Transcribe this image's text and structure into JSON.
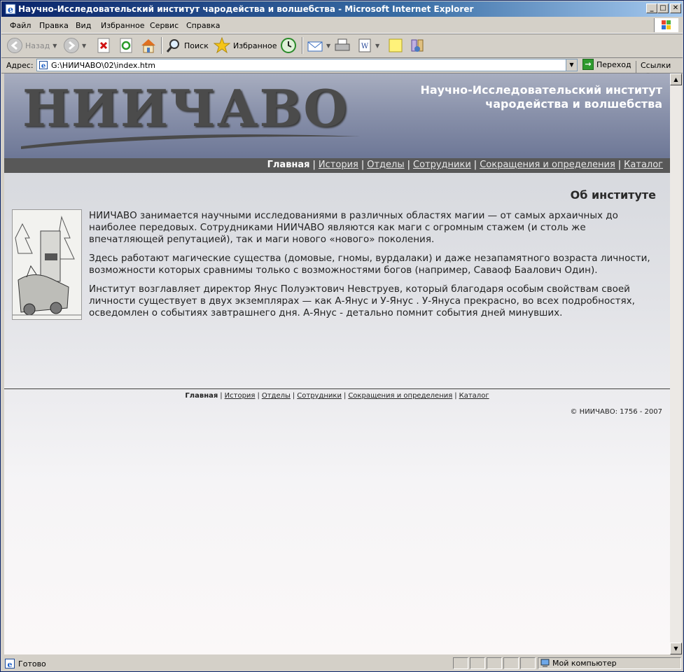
{
  "window": {
    "title": "Научно-Исследовательский институт чародейства и волшебства - Microsoft Internet Explorer",
    "minimize": "_",
    "maximize": "□",
    "close": "✕"
  },
  "menu": {
    "file": "Файл",
    "edit": "Правка",
    "view": "Вид",
    "favorites": "Избранное",
    "tools": "Сервис",
    "help": "Справка"
  },
  "toolbar": {
    "back": "Назад",
    "search": "Поиск",
    "favorites": "Избранное"
  },
  "address": {
    "label": "Адрес:",
    "url": "G:\\НИИЧАВО\\02\\index.htm",
    "go": "Переход",
    "links": "Ссылки",
    "more": "»"
  },
  "page": {
    "logo": "НИИЧАВО",
    "site_title_line1": "Научно-Исследовательский институт",
    "site_title_line2": "чародейства и волшебства",
    "nav": [
      "Главная",
      "История",
      "Отделы",
      "Сотрудники",
      "Сокращения и определения",
      "Каталог"
    ],
    "section_title": "Об институте",
    "paragraphs": [
      "НИИЧАВО занимается научными исследованиями в различных областях магии — от самых архаичных до наиболее передовых. Сотрудниками НИИЧАВО являются как маги с огромным стажем (и столь же впечатляющей репутацией), так и маги нового «нового» поколения.",
      "Здесь работают магические существа (домовые, гномы, вурдалаки) и даже незапамятного возраста личности, возможности которых сравнимы только с возможностями богов (например, Саваоф Баалович Один).",
      "Институт возглавляет директор Янус Полуэктович Невструев, который благодаря особым свойствам своей личности существует в двух экземплярах — как А-Янус и У-Янус . У-Януса прекрасно, во всех подробностях, осведомлен о событиях завтрашнего дня. А-Янус - детально помнит события дней минувших."
    ],
    "copyright": "© НИИЧАВО: 1756 - 2007"
  },
  "status": {
    "text": "Готово",
    "zone": "Мой компьютер"
  },
  "colors": {
    "titlebar": "#0a246a",
    "header": "#8a92ab",
    "navbar": "#585858"
  }
}
